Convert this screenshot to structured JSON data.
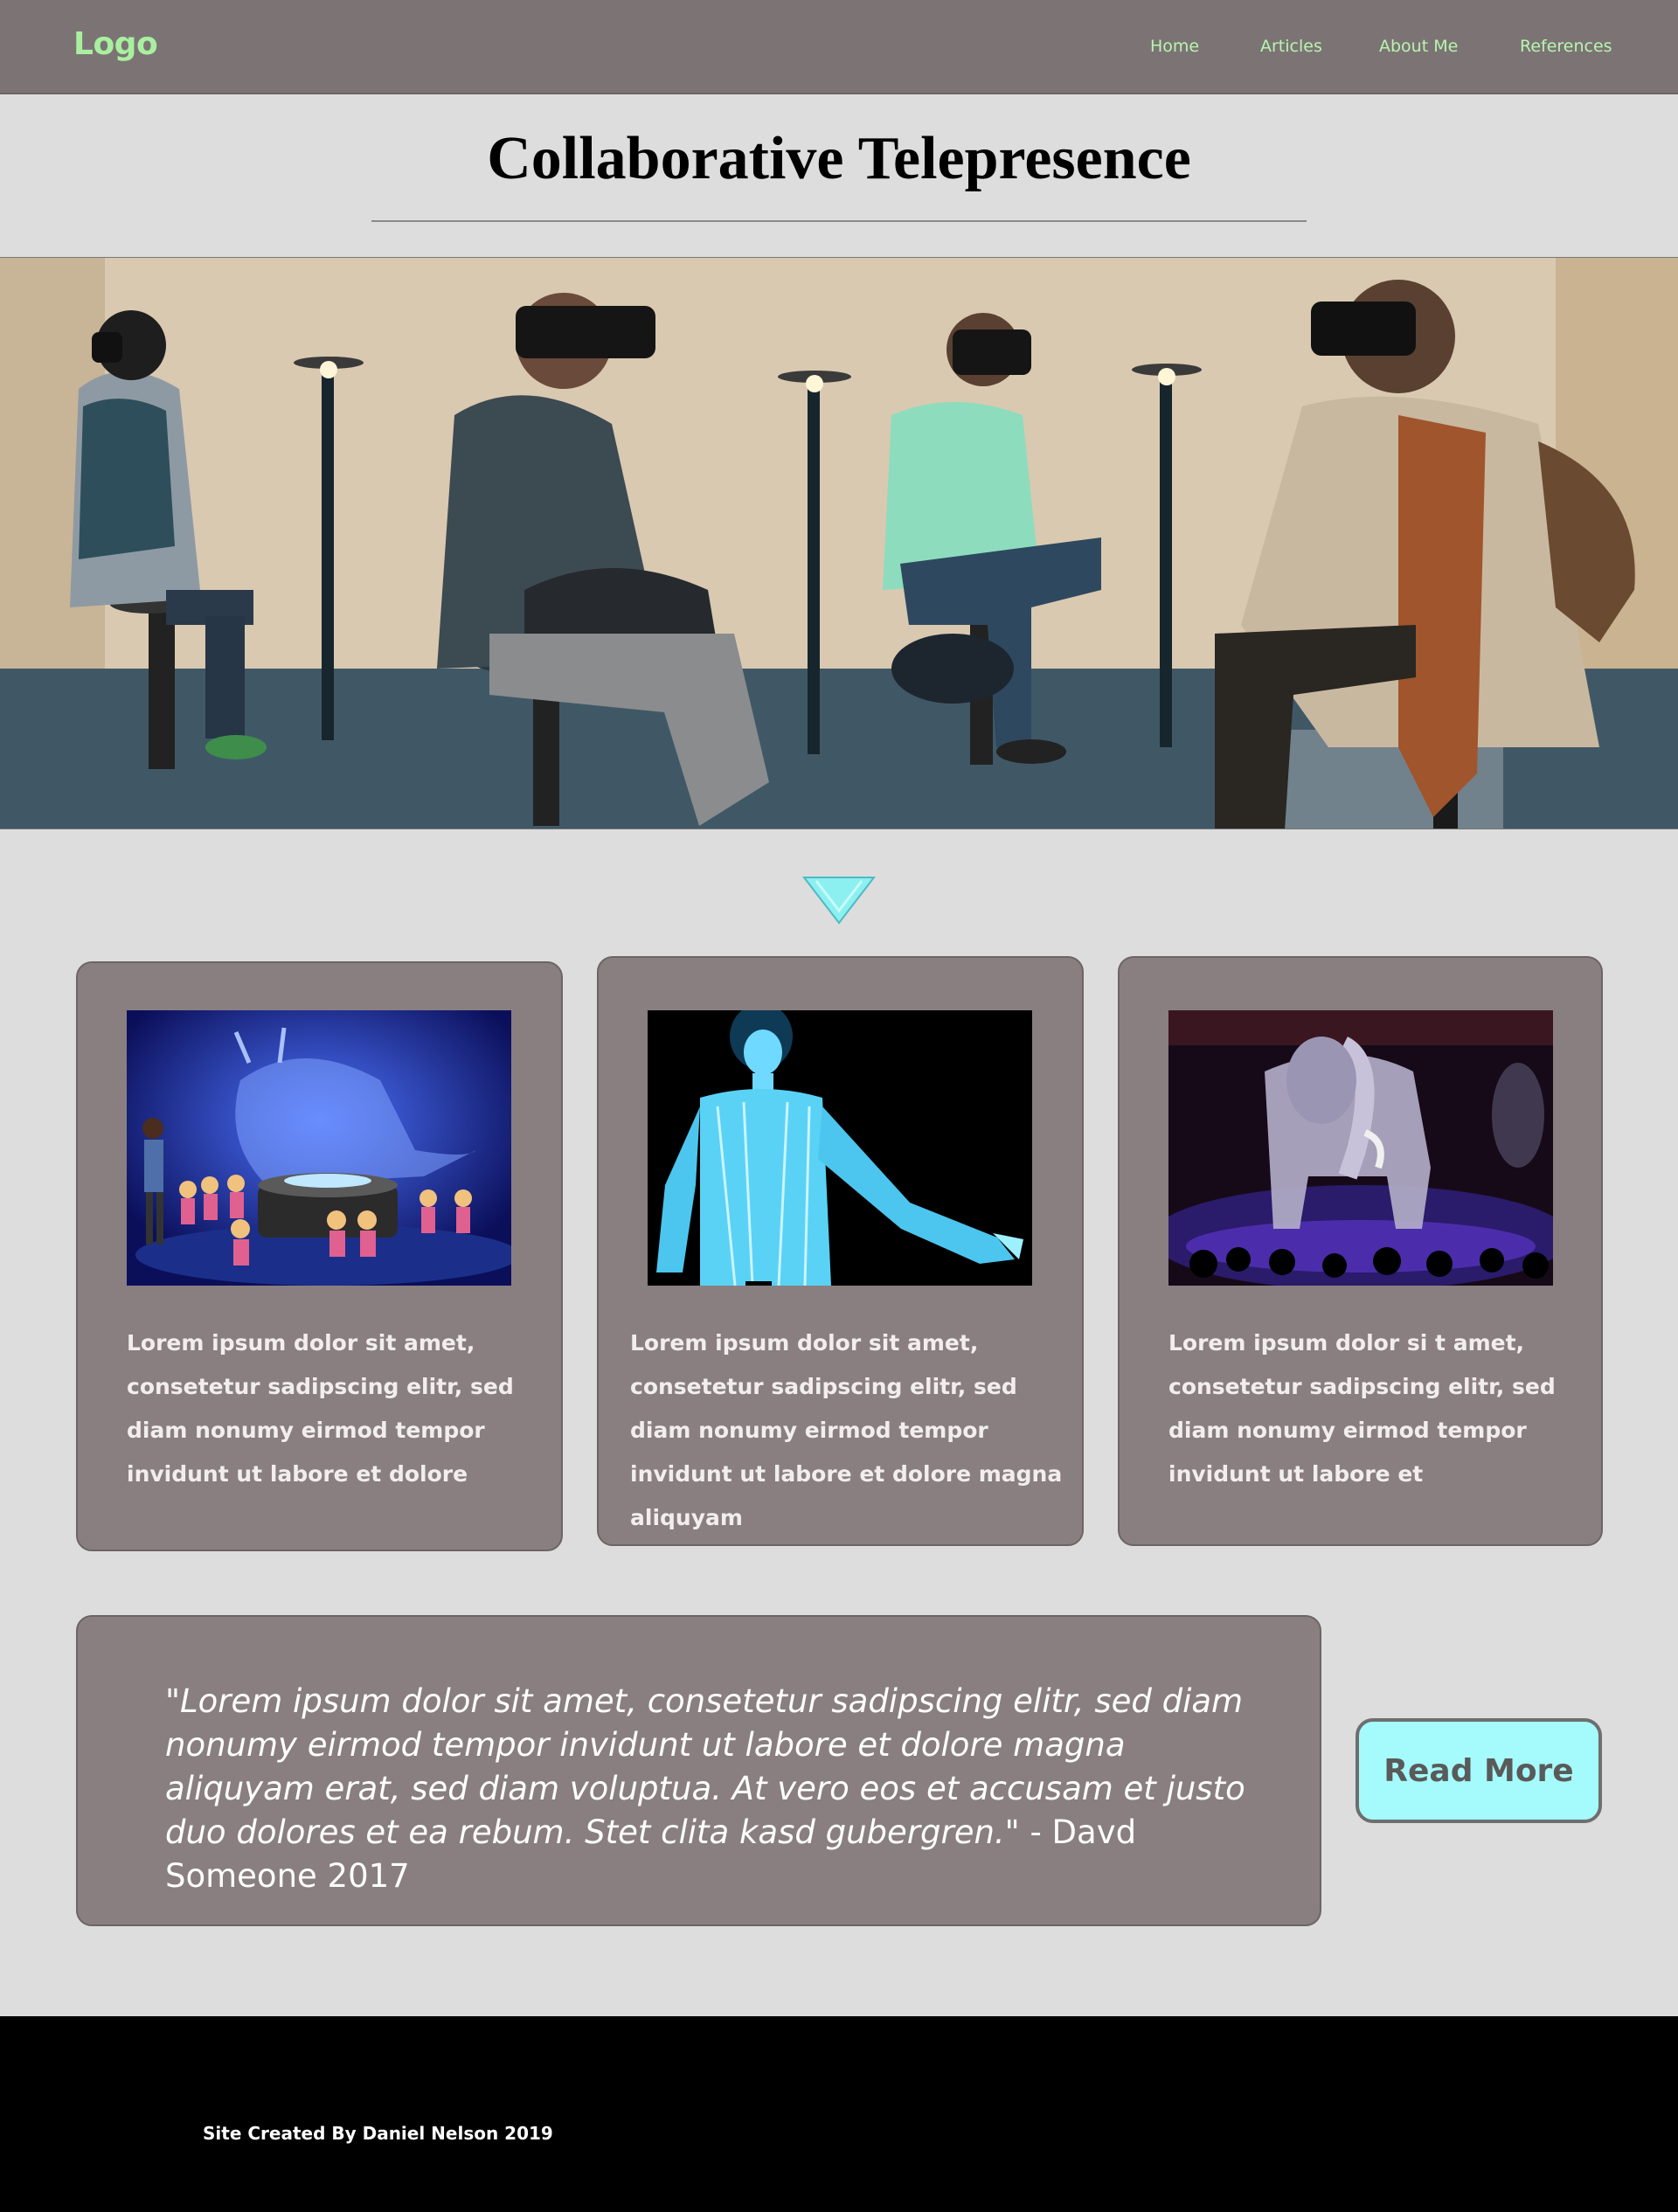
{
  "header": {
    "logo": "Logo",
    "nav": {
      "home": "Home",
      "articles": "Articles",
      "about": "About Me",
      "references": "References"
    },
    "accent_color": "#a8f0a0",
    "background_color": "#7c7474"
  },
  "main": {
    "title": "Collaborative Telepresence",
    "cards": [
      {
        "text": "Lorem ipsum dolor sit amet, consetetur sadipscing elitr, sed diam nonumy eirmod tempor invidunt ut labore et dolore"
      },
      {
        "text": "Lorem ipsum dolor sit amet, consetetur sadipscing elitr, sed diam nonumy eirmod tempor invidunt ut labore et dolore magna aliquyam"
      },
      {
        "text": "Lorem ipsum dolor si t amet, consetetur sadipscing elitr, sed diam nonumy eirmod tempor invidunt ut labore et"
      }
    ],
    "quote": {
      "text": "\"Lorem ipsum dolor sit amet, consetetur sadipscing elitr, sed diam nonumy eirmod tempor invidunt ut labore et dolore magna aliquyam erat, sed diam voluptua. At vero eos et accusam et justo duo dolores et ea rebum. Stet clita kasd gubergren.\"",
      "attribution": " - Davd Someone 2017"
    },
    "read_more": "Read More",
    "arrow_color": "#8cf0f0",
    "button_color": "#a5fbfb"
  },
  "footer": {
    "credit": "Site Created By Daniel Nelson 2019"
  }
}
